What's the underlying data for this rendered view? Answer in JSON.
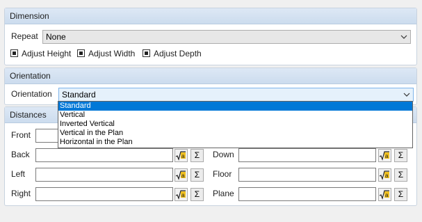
{
  "dimension": {
    "header": "Dimension",
    "repeat_label": "Repeat",
    "repeat_value": "None",
    "checkboxes": [
      {
        "label": "Adjust Height",
        "checked": true
      },
      {
        "label": "Adjust Width",
        "checked": true
      },
      {
        "label": "Adjust Depth",
        "checked": true
      }
    ]
  },
  "orientation": {
    "header": "Orientation",
    "label": "Orientation",
    "value": "Standard",
    "options": [
      "Standard",
      "Vertical",
      "Inverted Vertical",
      "Vertical in the Plan",
      "Horizontal in the Plan"
    ]
  },
  "distances": {
    "header": "Distances",
    "left_fields": [
      {
        "label": "Front",
        "value": ""
      },
      {
        "label": "Back",
        "value": ""
      },
      {
        "label": "Left",
        "value": ""
      },
      {
        "label": "Right",
        "value": ""
      }
    ],
    "right_fields": [
      {
        "label": "Down",
        "value": ""
      },
      {
        "label": "Floor",
        "value": ""
      },
      {
        "label": "Plane",
        "value": ""
      }
    ],
    "sum_symbol": "Σ"
  },
  "colors": {
    "header_bg": "#ccdcee",
    "selection": "#0078d7",
    "formula_icon_yellow": "#f0c020"
  },
  "icons": {
    "formula": "formula-sqrt-a-icon",
    "sum": "sigma-icon",
    "dropdown": "chevron-down-icon"
  }
}
